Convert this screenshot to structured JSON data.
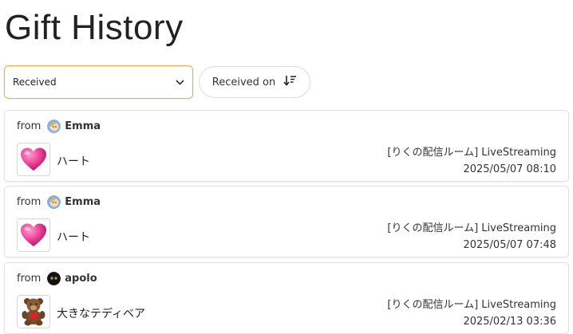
{
  "page": {
    "title": "Gift History"
  },
  "filter": {
    "selected": "Received",
    "icon": "chevron-down-icon"
  },
  "sort": {
    "label": "Received on",
    "icon": "sort-descending-icon"
  },
  "gifts": [
    {
      "from_label": "from",
      "sender": "Emma",
      "avatar": "emma-avatar",
      "gift_name": "ハート",
      "gift_icon": "heart-gift-icon",
      "room": "[りくの配信ルーム] LiveStreaming",
      "datetime": "2025/05/07 08:10"
    },
    {
      "from_label": "from",
      "sender": "Emma",
      "avatar": "emma-avatar",
      "gift_name": "ハート",
      "gift_icon": "heart-gift-icon",
      "room": "[りくの配信ルーム] LiveStreaming",
      "datetime": "2025/05/07 07:48"
    },
    {
      "from_label": "from",
      "sender": "apolo",
      "avatar": "apolo-avatar",
      "gift_name": "大きなテディベア",
      "gift_icon": "teddy-bear-gift-icon",
      "room": "[りくの配信ルーム] LiveStreaming",
      "datetime": "2025/02/13 03:36"
    }
  ]
}
